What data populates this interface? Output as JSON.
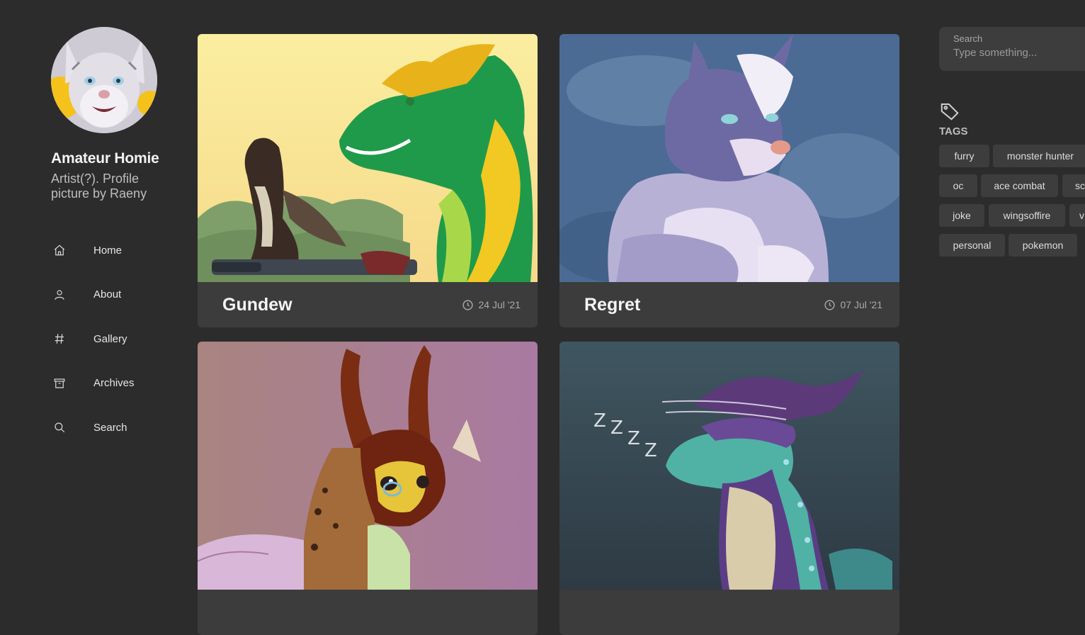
{
  "profile": {
    "name": "Amateur Homie",
    "bio": "Artist(?). Profile picture by Raeny"
  },
  "nav": {
    "items": [
      {
        "label": "Home",
        "icon": "home-icon"
      },
      {
        "label": "About",
        "icon": "user-icon"
      },
      {
        "label": "Gallery",
        "icon": "hash-icon"
      },
      {
        "label": "Archives",
        "icon": "archive-icon"
      },
      {
        "label": "Search",
        "icon": "search-icon"
      }
    ]
  },
  "posts": [
    {
      "title": "Gundew",
      "date": "24 Jul '21"
    },
    {
      "title": "Regret",
      "date": "07 Jul '21"
    },
    {
      "title": "",
      "date": ""
    },
    {
      "title": "",
      "date": ""
    }
  ],
  "search": {
    "label": "Search",
    "placeholder": "Type something..."
  },
  "tags": {
    "heading": "TAGS",
    "icon": "tag-icon",
    "items": [
      "furry",
      "monster hunter",
      "oc",
      "ace combat",
      "sc",
      "joke",
      "wingsoffire",
      "v",
      "personal",
      "pokemon"
    ]
  },
  "colors": {
    "background": "#2c2c2c",
    "card": "#3c3c3c",
    "panel": "#3d3d3d"
  }
}
